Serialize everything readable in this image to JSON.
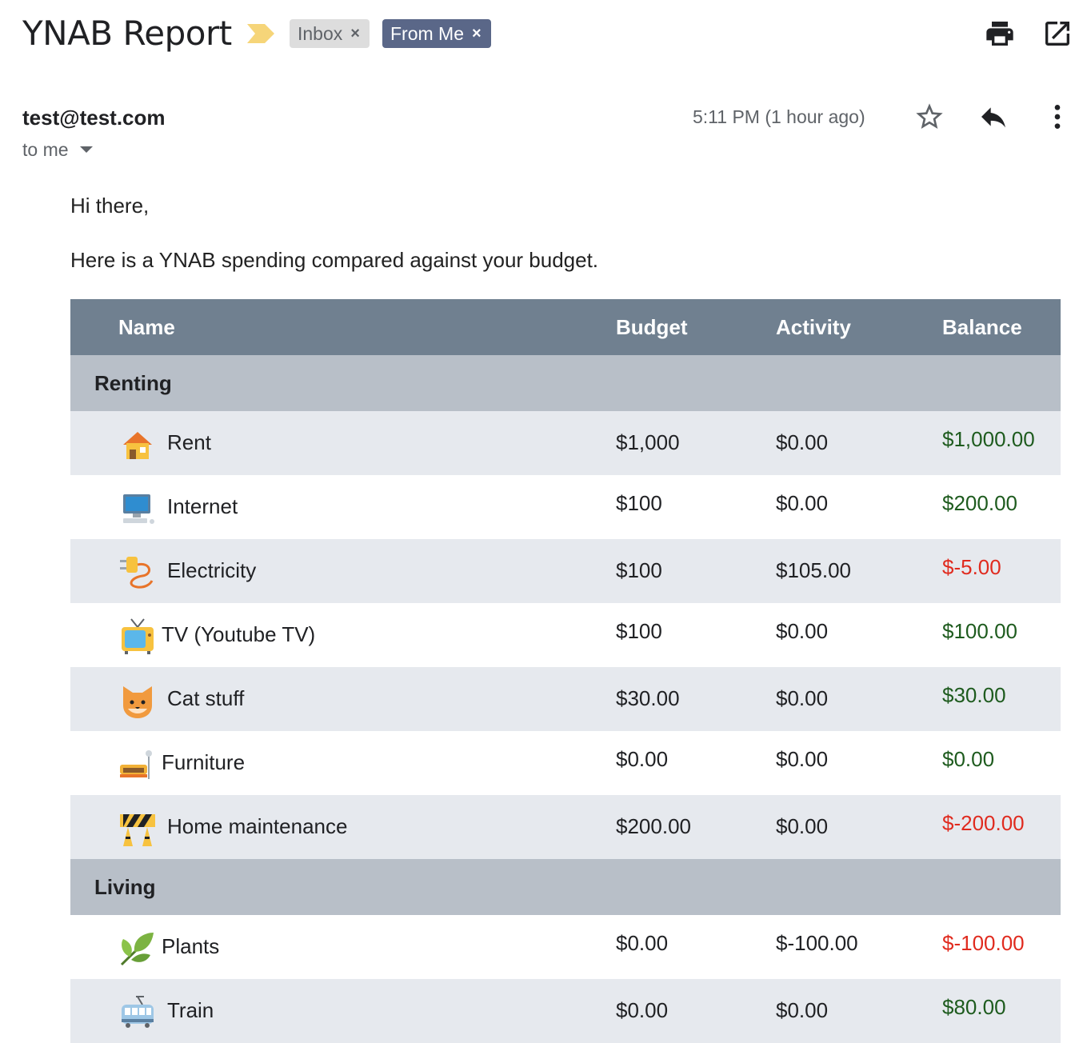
{
  "email": {
    "subject": "YNAB Report",
    "labels": [
      {
        "text": "Inbox",
        "remove": "×"
      },
      {
        "text": "From Me",
        "remove": "×"
      }
    ],
    "sender": "test@test.com",
    "recipient": "to me",
    "timestamp": "5:11 PM (1 hour ago)",
    "greeting": "Hi there,",
    "intro": "Here is a YNAB spending compared against your budget."
  },
  "colors": {
    "header_bg": "#708090",
    "group_bg": "#b8bfc8",
    "row_alt_bg": "#e6e9ee",
    "positive": "#1e5b1e",
    "negative": "#e02b1f",
    "chip_from_me": "#5a6788",
    "chip_inbox": "#dddddd"
  },
  "table": {
    "columns": [
      "Name",
      "Budget",
      "Activity",
      "Balance"
    ],
    "groups": [
      {
        "name": "Renting",
        "rows": [
          {
            "icon": "house-icon",
            "name": "Rent",
            "budget": "$1,000",
            "activity": "$0.00",
            "balance": "$1,000.00",
            "status": "positive"
          },
          {
            "icon": "desktop-computer-icon",
            "name": "Internet",
            "budget": "$100",
            "activity": "$0.00",
            "balance": "$200.00",
            "status": "positive"
          },
          {
            "icon": "electric-plug-icon",
            "name": "Electricity",
            "budget": "$100",
            "activity": "$105.00",
            "balance": "$-5.00",
            "status": "negative"
          },
          {
            "icon": "television-icon",
            "name": "TV (Youtube TV)",
            "budget": "$100",
            "activity": "$0.00",
            "balance": "$100.00",
            "status": "positive"
          },
          {
            "icon": "cat-face-icon",
            "name": "Cat stuff",
            "budget": "$30.00",
            "activity": "$0.00",
            "balance": "$30.00",
            "status": "positive"
          },
          {
            "icon": "couch-lamp-icon",
            "name": "Furniture",
            "budget": "$0.00",
            "activity": "$0.00",
            "balance": "$0.00",
            "status": "positive"
          },
          {
            "icon": "construction-barrier-icon",
            "name": "Home maintenance",
            "budget": "$200.00",
            "activity": "$0.00",
            "balance": "$-200.00",
            "status": "negative"
          }
        ]
      },
      {
        "name": "Living",
        "rows": [
          {
            "icon": "herb-leaf-icon",
            "name": "Plants",
            "budget": "$0.00",
            "activity": "$-100.00",
            "balance": "$-100.00",
            "status": "negative"
          },
          {
            "icon": "tram-icon",
            "name": "Train",
            "budget": "$0.00",
            "activity": "$0.00",
            "balance": "$80.00",
            "status": "positive"
          }
        ]
      }
    ]
  }
}
